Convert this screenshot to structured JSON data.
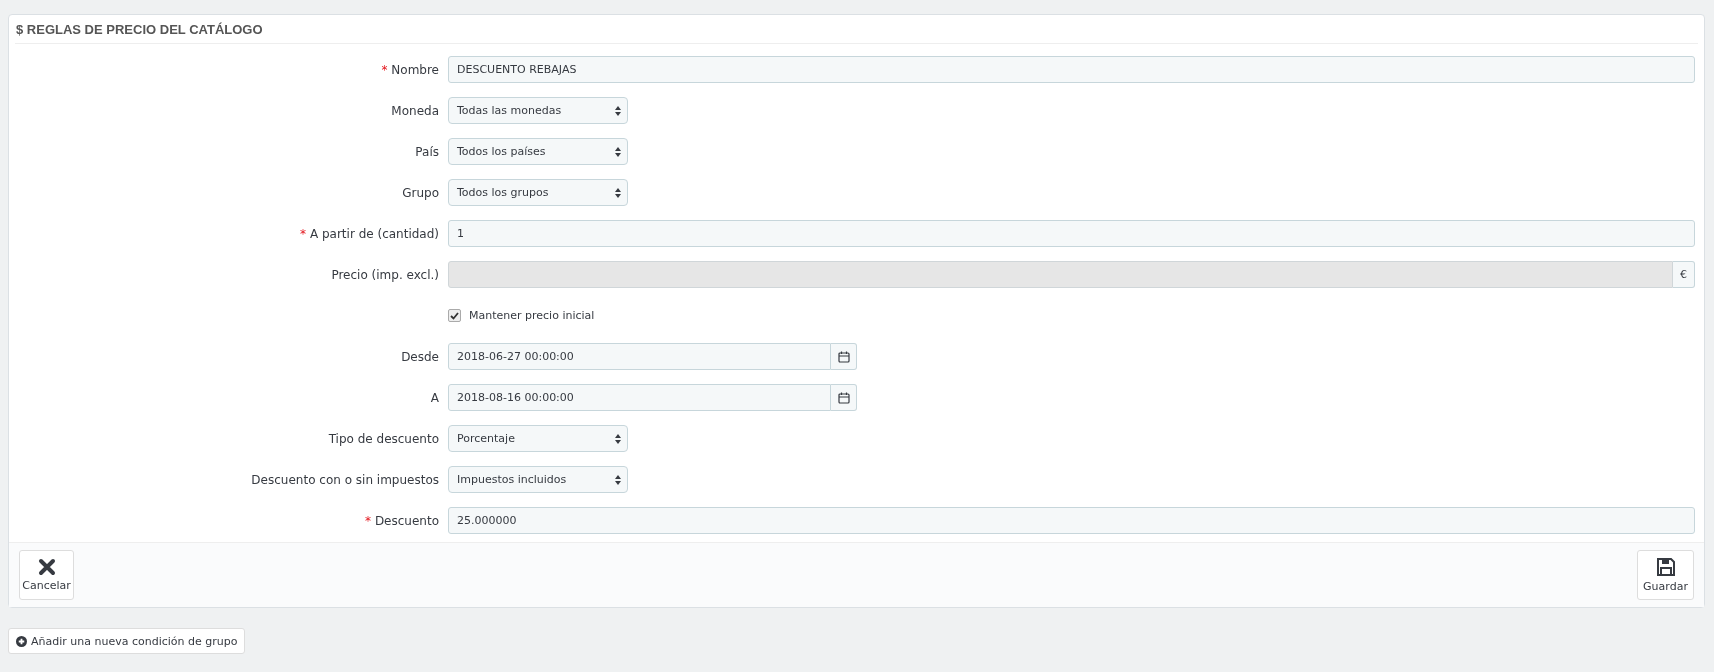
{
  "panel": {
    "title": "$ REGLAS DE PRECIO DEL CATÁLOGO"
  },
  "required_mark": "*",
  "fields": [
    {
      "kind": "text",
      "label": "Nombre",
      "required": true,
      "value": "DESCUENTO REBAJAS"
    },
    {
      "kind": "select",
      "label": "Moneda",
      "required": false,
      "value": "Todas las monedas"
    },
    {
      "kind": "select",
      "label": "País",
      "required": false,
      "value": "Todos los países"
    },
    {
      "kind": "select",
      "label": "Grupo",
      "required": false,
      "value": "Todos los grupos"
    },
    {
      "kind": "text",
      "label": "A partir de (cantidad)",
      "required": true,
      "value": "1"
    },
    {
      "kind": "addon",
      "label": "Precio (imp. excl.)",
      "required": false,
      "disabled": true,
      "addon": "€"
    },
    {
      "kind": "checkbox",
      "label": "Mantener precio inicial",
      "checked": true
    },
    {
      "kind": "date",
      "label": "Desde",
      "required": false,
      "value": "2018-06-27 00:00:00"
    },
    {
      "kind": "date",
      "label": "A",
      "required": false,
      "value": "2018-08-16 00:00:00"
    },
    {
      "kind": "select",
      "label": "Tipo de descuento",
      "required": false,
      "value": "Porcentaje"
    },
    {
      "kind": "select",
      "label": "Descuento con o sin impuestos",
      "required": false,
      "value": "Impuestos incluidos"
    },
    {
      "kind": "text",
      "label": "Descuento",
      "required": true,
      "value": "25.000000"
    }
  ],
  "footer": {
    "cancel": "Cancelar",
    "save": "Guardar"
  },
  "add_condition": "Añadir una nueva condición de grupo"
}
